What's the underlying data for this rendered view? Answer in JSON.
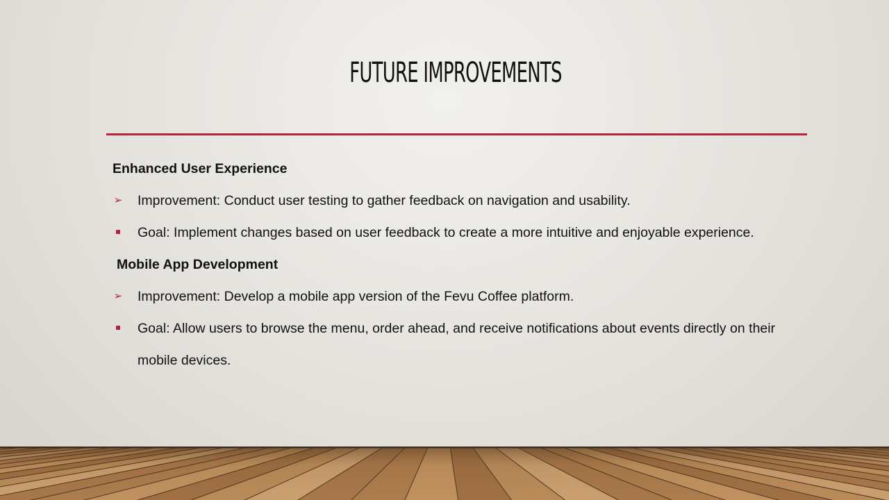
{
  "slide": {
    "title": "FUTURE IMPROVEMENTS",
    "accent_color": "#b52340",
    "sections": [
      {
        "heading": "Enhanced User Experience",
        "items": [
          {
            "bullet": "arrow-bullet-icon",
            "text": "Improvement: Conduct user testing to gather feedback on navigation and usability."
          },
          {
            "bullet": "square-bullet-icon",
            "text": "Goal: Implement changes based on user feedback to create a more intuitive and enjoyable experience."
          }
        ]
      },
      {
        "heading": "Mobile App Development",
        "items": [
          {
            "bullet": "arrow-bullet-icon",
            "text": "Improvement: Develop a mobile app version of the Fevu Coffee platform."
          },
          {
            "bullet": "square-bullet-icon",
            "text": "Goal: Allow users to browse the menu, order ahead, and receive notifications about events directly on their mobile devices."
          }
        ]
      }
    ]
  }
}
